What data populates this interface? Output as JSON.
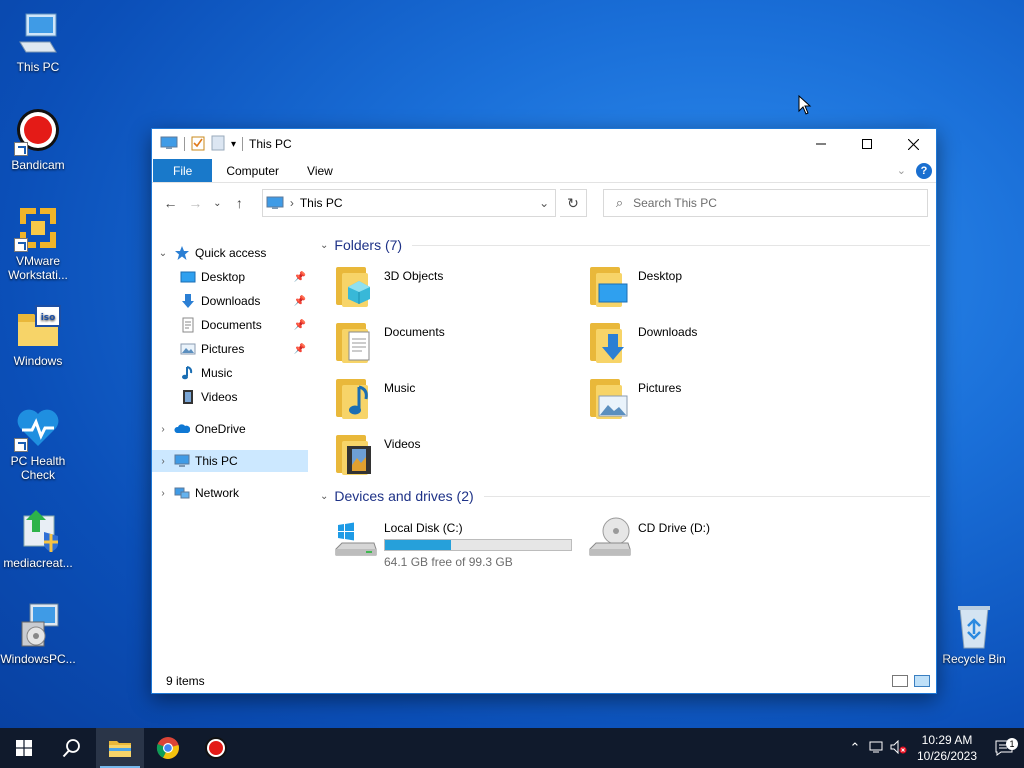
{
  "desktop": {
    "icons": [
      {
        "label": "This PC"
      },
      {
        "label": "Bandicam"
      },
      {
        "label": "VMware Workstati..."
      },
      {
        "label": "Windows"
      },
      {
        "label": "PC Health Check"
      },
      {
        "label": "mediacreat..."
      },
      {
        "label": "WindowsPC..."
      },
      {
        "label": "Recycle Bin"
      }
    ]
  },
  "window": {
    "title": "This PC",
    "ribbon_tabs": [
      "File",
      "Computer",
      "View"
    ],
    "address": {
      "location": "This PC"
    },
    "search": {
      "placeholder": "Search This PC"
    }
  },
  "navpane": {
    "quick_access": "Quick access",
    "quick_items": [
      "Desktop",
      "Downloads",
      "Documents",
      "Pictures",
      "Music",
      "Videos"
    ],
    "onedrive": "OneDrive",
    "this_pc": "This PC",
    "network": "Network"
  },
  "content": {
    "folders_header": "Folders (7)",
    "folders": [
      "3D Objects",
      "Desktop",
      "Documents",
      "Downloads",
      "Music",
      "Pictures",
      "Videos"
    ],
    "drives_header": "Devices and drives (2)",
    "drives": [
      {
        "name": "Local Disk (C:)",
        "free_text": "64.1 GB free of 99.3 GB",
        "used_fraction": 0.355
      },
      {
        "name": "CD Drive (D:)"
      }
    ]
  },
  "statusbar": {
    "items": "9 items"
  },
  "taskbar": {
    "time": "10:29 AM",
    "date": "10/26/2023",
    "notification_count": "1"
  },
  "colors": {
    "accent": "#1979ca",
    "selection": "#cce8ff",
    "group_header": "#1e3287",
    "drive_fill": "#26a0da",
    "taskbar": "#101a2c"
  }
}
